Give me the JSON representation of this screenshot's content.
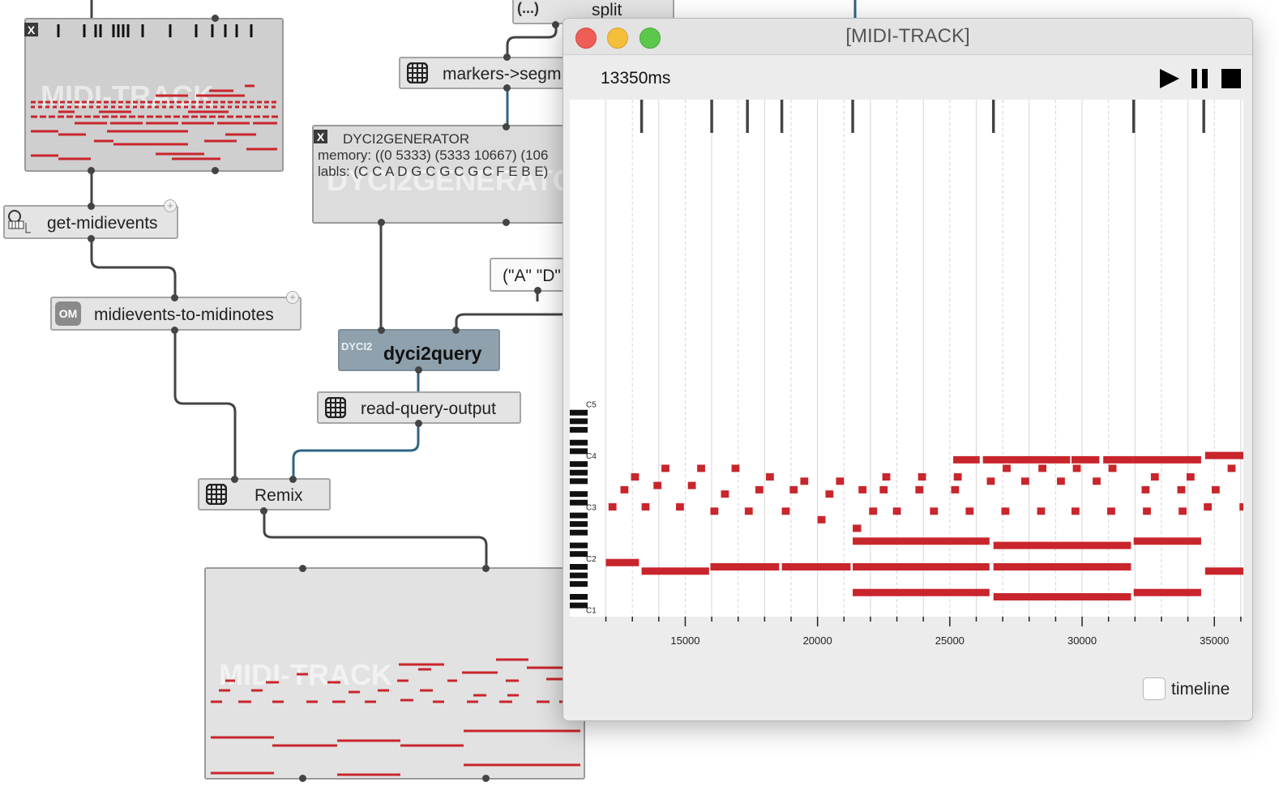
{
  "patch": {
    "top_partial_label": "split",
    "top_partial_marker": "(...)",
    "midi_track_label": "MIDI-TRACK",
    "get_midievents": "get-midievents",
    "midievents_to_midinotes": "midievents-to-midinotes",
    "om_badge": "OM",
    "markers_segments": "markers->segm",
    "dyci2generator": {
      "title": "DYCI2GENERATOR",
      "memory": "memory: ((0 5333) (5333 10667) (106",
      "labels": "labls: (C C A D G C G C G C F E B E)",
      "watermark": "DYCI2GENERATOR"
    },
    "list_box": "(\"A\" \"D\"",
    "dyci2query": "dyci2query",
    "dyci2_badge": "DYCI2",
    "read_query_output": "read-query-output",
    "remix": "Remix",
    "close_glyph": "X",
    "plus_glyph": "+"
  },
  "editor": {
    "title": "[MIDI-TRACK]",
    "time_readout": "13350ms",
    "play_icon": "play-icon",
    "pause_icon": "pause-icon",
    "stop_icon": "stop-icon",
    "octave_labels": [
      "C5",
      "C4",
      "C3",
      "C2",
      "C1"
    ],
    "xaxis_labels": [
      "15000",
      "20000",
      "25000",
      "30000",
      "35000"
    ],
    "timeline_label": "timeline",
    "timeline_checked": false,
    "note_color": "#c9252c"
  },
  "chart_data": {
    "type": "piano-roll",
    "xlabel": "",
    "ylabel": "",
    "time_unit": "ms",
    "x_ticks": [
      15000,
      20000,
      25000,
      30000,
      35000
    ],
    "pitch_octaves": [
      "C1",
      "C2",
      "C3",
      "C4",
      "C5"
    ],
    "markers_ms": [
      13350,
      16000,
      17350,
      18650,
      21330,
      26650,
      31950,
      34600
    ],
    "notes": [
      {
        "start": 25130,
        "end": 26130,
        "pitch": 71
      },
      {
        "start": 26250,
        "end": 29550,
        "pitch": 71
      },
      {
        "start": 29600,
        "end": 30650,
        "pitch": 71
      },
      {
        "start": 30800,
        "end": 31900,
        "pitch": 71
      },
      {
        "start": 31900,
        "end": 34500,
        "pitch": 71
      },
      {
        "start": 34650,
        "end": 36350,
        "pitch": 72
      },
      {
        "start": 14100,
        "end": 14400,
        "pitch": 69
      },
      {
        "start": 15450,
        "end": 15750,
        "pitch": 69
      },
      {
        "start": 16750,
        "end": 17050,
        "pitch": 69
      },
      {
        "start": 27000,
        "end": 27300,
        "pitch": 69
      },
      {
        "start": 28350,
        "end": 28650,
        "pitch": 69
      },
      {
        "start": 29650,
        "end": 29950,
        "pitch": 69
      },
      {
        "start": 31000,
        "end": 31300,
        "pitch": 69
      },
      {
        "start": 35500,
        "end": 35800,
        "pitch": 69
      },
      {
        "start": 12950,
        "end": 13250,
        "pitch": 67
      },
      {
        "start": 18050,
        "end": 18350,
        "pitch": 67
      },
      {
        "start": 22450,
        "end": 22750,
        "pitch": 67
      },
      {
        "start": 23800,
        "end": 24100,
        "pitch": 67
      },
      {
        "start": 25150,
        "end": 25450,
        "pitch": 67
      },
      {
        "start": 32600,
        "end": 32900,
        "pitch": 67
      },
      {
        "start": 33950,
        "end": 34250,
        "pitch": 67
      },
      {
        "start": 19350,
        "end": 19650,
        "pitch": 66
      },
      {
        "start": 20700,
        "end": 21000,
        "pitch": 66
      },
      {
        "start": 26400,
        "end": 26700,
        "pitch": 66
      },
      {
        "start": 27700,
        "end": 28000,
        "pitch": 66
      },
      {
        "start": 29050,
        "end": 29350,
        "pitch": 66
      },
      {
        "start": 30400,
        "end": 30700,
        "pitch": 66
      },
      {
        "start": 13800,
        "end": 14100,
        "pitch": 65
      },
      {
        "start": 15100,
        "end": 15400,
        "pitch": 65
      },
      {
        "start": 12550,
        "end": 12850,
        "pitch": 64
      },
      {
        "start": 17650,
        "end": 17950,
        "pitch": 64
      },
      {
        "start": 18950,
        "end": 19250,
        "pitch": 64
      },
      {
        "start": 21550,
        "end": 21850,
        "pitch": 64
      },
      {
        "start": 22350,
        "end": 22650,
        "pitch": 64
      },
      {
        "start": 23700,
        "end": 24000,
        "pitch": 64
      },
      {
        "start": 25050,
        "end": 25350,
        "pitch": 64
      },
      {
        "start": 32250,
        "end": 32550,
        "pitch": 64
      },
      {
        "start": 33600,
        "end": 33900,
        "pitch": 64
      },
      {
        "start": 34900,
        "end": 35200,
        "pitch": 64
      },
      {
        "start": 16350,
        "end": 16650,
        "pitch": 63
      },
      {
        "start": 20300,
        "end": 20600,
        "pitch": 63
      },
      {
        "start": 12100,
        "end": 12400,
        "pitch": 60
      },
      {
        "start": 13350,
        "end": 13650,
        "pitch": 60
      },
      {
        "start": 14650,
        "end": 14950,
        "pitch": 60
      },
      {
        "start": 34600,
        "end": 34900,
        "pitch": 60
      },
      {
        "start": 35950,
        "end": 36250,
        "pitch": 60
      },
      {
        "start": 15950,
        "end": 16250,
        "pitch": 59
      },
      {
        "start": 17250,
        "end": 17550,
        "pitch": 59
      },
      {
        "start": 18650,
        "end": 18950,
        "pitch": 59
      },
      {
        "start": 21950,
        "end": 22250,
        "pitch": 59
      },
      {
        "start": 22850,
        "end": 23150,
        "pitch": 59
      },
      {
        "start": 24250,
        "end": 24550,
        "pitch": 59
      },
      {
        "start": 25600,
        "end": 25900,
        "pitch": 59
      },
      {
        "start": 26950,
        "end": 27250,
        "pitch": 59
      },
      {
        "start": 28300,
        "end": 28600,
        "pitch": 59
      },
      {
        "start": 29600,
        "end": 29900,
        "pitch": 59
      },
      {
        "start": 30950,
        "end": 31250,
        "pitch": 59
      },
      {
        "start": 32300,
        "end": 32600,
        "pitch": 59
      },
      {
        "start": 33650,
        "end": 33950,
        "pitch": 59
      },
      {
        "start": 20000,
        "end": 20300,
        "pitch": 57
      },
      {
        "start": 21330,
        "end": 21650,
        "pitch": 55
      },
      {
        "start": 21330,
        "end": 26500,
        "pitch": 52
      },
      {
        "start": 31950,
        "end": 34500,
        "pitch": 52
      },
      {
        "start": 26650,
        "end": 31850,
        "pitch": 51
      },
      {
        "start": 12000,
        "end": 13250,
        "pitch": 47
      },
      {
        "start": 15950,
        "end": 18550,
        "pitch": 46
      },
      {
        "start": 18650,
        "end": 21250,
        "pitch": 46
      },
      {
        "start": 21330,
        "end": 26500,
        "pitch": 46
      },
      {
        "start": 26650,
        "end": 31850,
        "pitch": 46
      },
      {
        "start": 13350,
        "end": 15900,
        "pitch": 45
      },
      {
        "start": 34650,
        "end": 36350,
        "pitch": 45
      },
      {
        "start": 21330,
        "end": 26500,
        "pitch": 40
      },
      {
        "start": 31950,
        "end": 34500,
        "pitch": 40
      },
      {
        "start": 26650,
        "end": 31850,
        "pitch": 39
      }
    ]
  }
}
